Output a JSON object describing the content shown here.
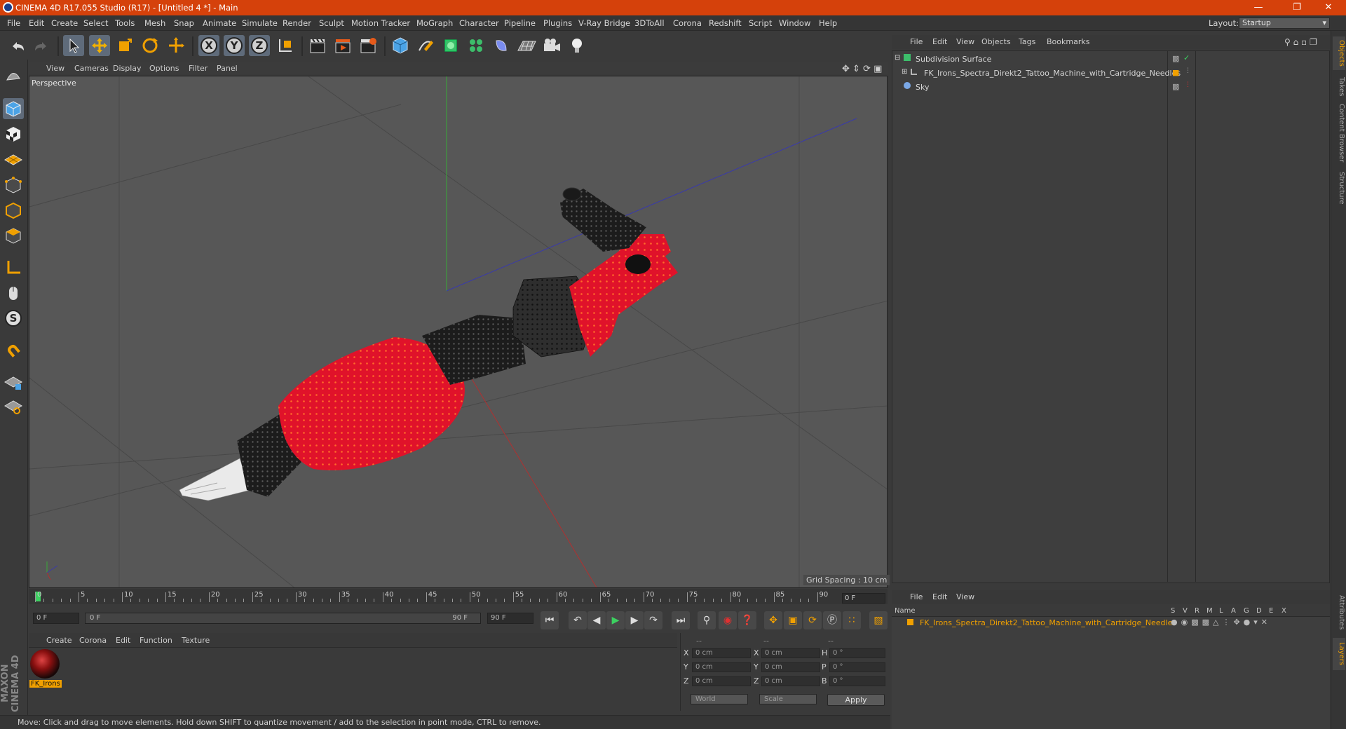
{
  "app": {
    "title": "CINEMA 4D R17.055 Studio (R17) - [Untitled 4 *] - Main"
  },
  "menu": [
    "File",
    "Edit",
    "Create",
    "Select",
    "Tools",
    "Mesh",
    "Snap",
    "Animate",
    "Simulate",
    "Render",
    "Sculpt",
    "Motion Tracker",
    "MoGraph",
    "Character",
    "Pipeline",
    "Plugins",
    "V-Ray Bridge",
    "3DToAll",
    "Corona",
    "Redshift",
    "Script",
    "Window",
    "Help"
  ],
  "layout": {
    "label": "Layout:",
    "value": "Startup"
  },
  "viewport": {
    "menu": [
      "View",
      "Cameras",
      "Display",
      "Options",
      "Filter",
      "Panel"
    ],
    "camera_label": "Perspective",
    "grid_spacing": "Grid Spacing : 10 cm"
  },
  "timeline": {
    "ticks": [
      "0",
      "5",
      "10",
      "15",
      "20",
      "25",
      "30",
      "35",
      "40",
      "45",
      "50",
      "55",
      "60",
      "65",
      "70",
      "75",
      "80",
      "85",
      "90"
    ],
    "current_frame": "0 F",
    "start_frame": "0 F",
    "range_start": "0 F",
    "range_end": "90 F",
    "end_frame": "90 F"
  },
  "material_manager": {
    "menu": [
      "Create",
      "Corona",
      "Edit",
      "Function",
      "Texture"
    ],
    "materials": [
      {
        "name": "FK_Irons"
      }
    ]
  },
  "coordinates": {
    "header": [
      "--",
      "--",
      "--"
    ],
    "rows": [
      {
        "l1": "X",
        "v1": "0 cm",
        "l2": "X",
        "v2": "0 cm",
        "l3": "H",
        "v3": "0 °"
      },
      {
        "l1": "Y",
        "v1": "0 cm",
        "l2": "Y",
        "v2": "0 cm",
        "l3": "P",
        "v3": "0 °"
      },
      {
        "l1": "Z",
        "v1": "0 cm",
        "l2": "Z",
        "v2": "0 cm",
        "l3": "B",
        "v3": "0 °"
      }
    ],
    "space": "World",
    "mode": "Scale",
    "apply": "Apply"
  },
  "status": "Move: Click and drag to move elements. Hold down SHIFT to quantize movement / add to the selection in point mode, CTRL to remove.",
  "object_manager": {
    "menu": [
      "File",
      "Edit",
      "View",
      "Objects",
      "Tags",
      "Bookmarks"
    ],
    "objects": [
      {
        "name": "Subdivision Surface"
      },
      {
        "name": "FK_Irons_Spectra_Direkt2_Tattoo_Machine_with_Cartridge_Needles"
      },
      {
        "name": "Sky"
      }
    ]
  },
  "layer_manager": {
    "menu": [
      "File",
      "Edit",
      "View"
    ],
    "header_name": "Name",
    "columns": [
      "S",
      "V",
      "R",
      "M",
      "L",
      "A",
      "G",
      "D",
      "E",
      "X"
    ],
    "layers": [
      {
        "name": "FK_Irons_Spectra_Direkt2_Tattoo_Machine_with_Cartridge_Needles"
      }
    ]
  },
  "side_tabs": [
    "Objects",
    "Takes",
    "Content Browser",
    "Structure",
    "Attributes",
    "Layers"
  ],
  "colors": {
    "titlebar": "#d5410b",
    "accent": "#f0a000",
    "model_red": "#e0122a",
    "model_black": "#1c1c1c"
  }
}
